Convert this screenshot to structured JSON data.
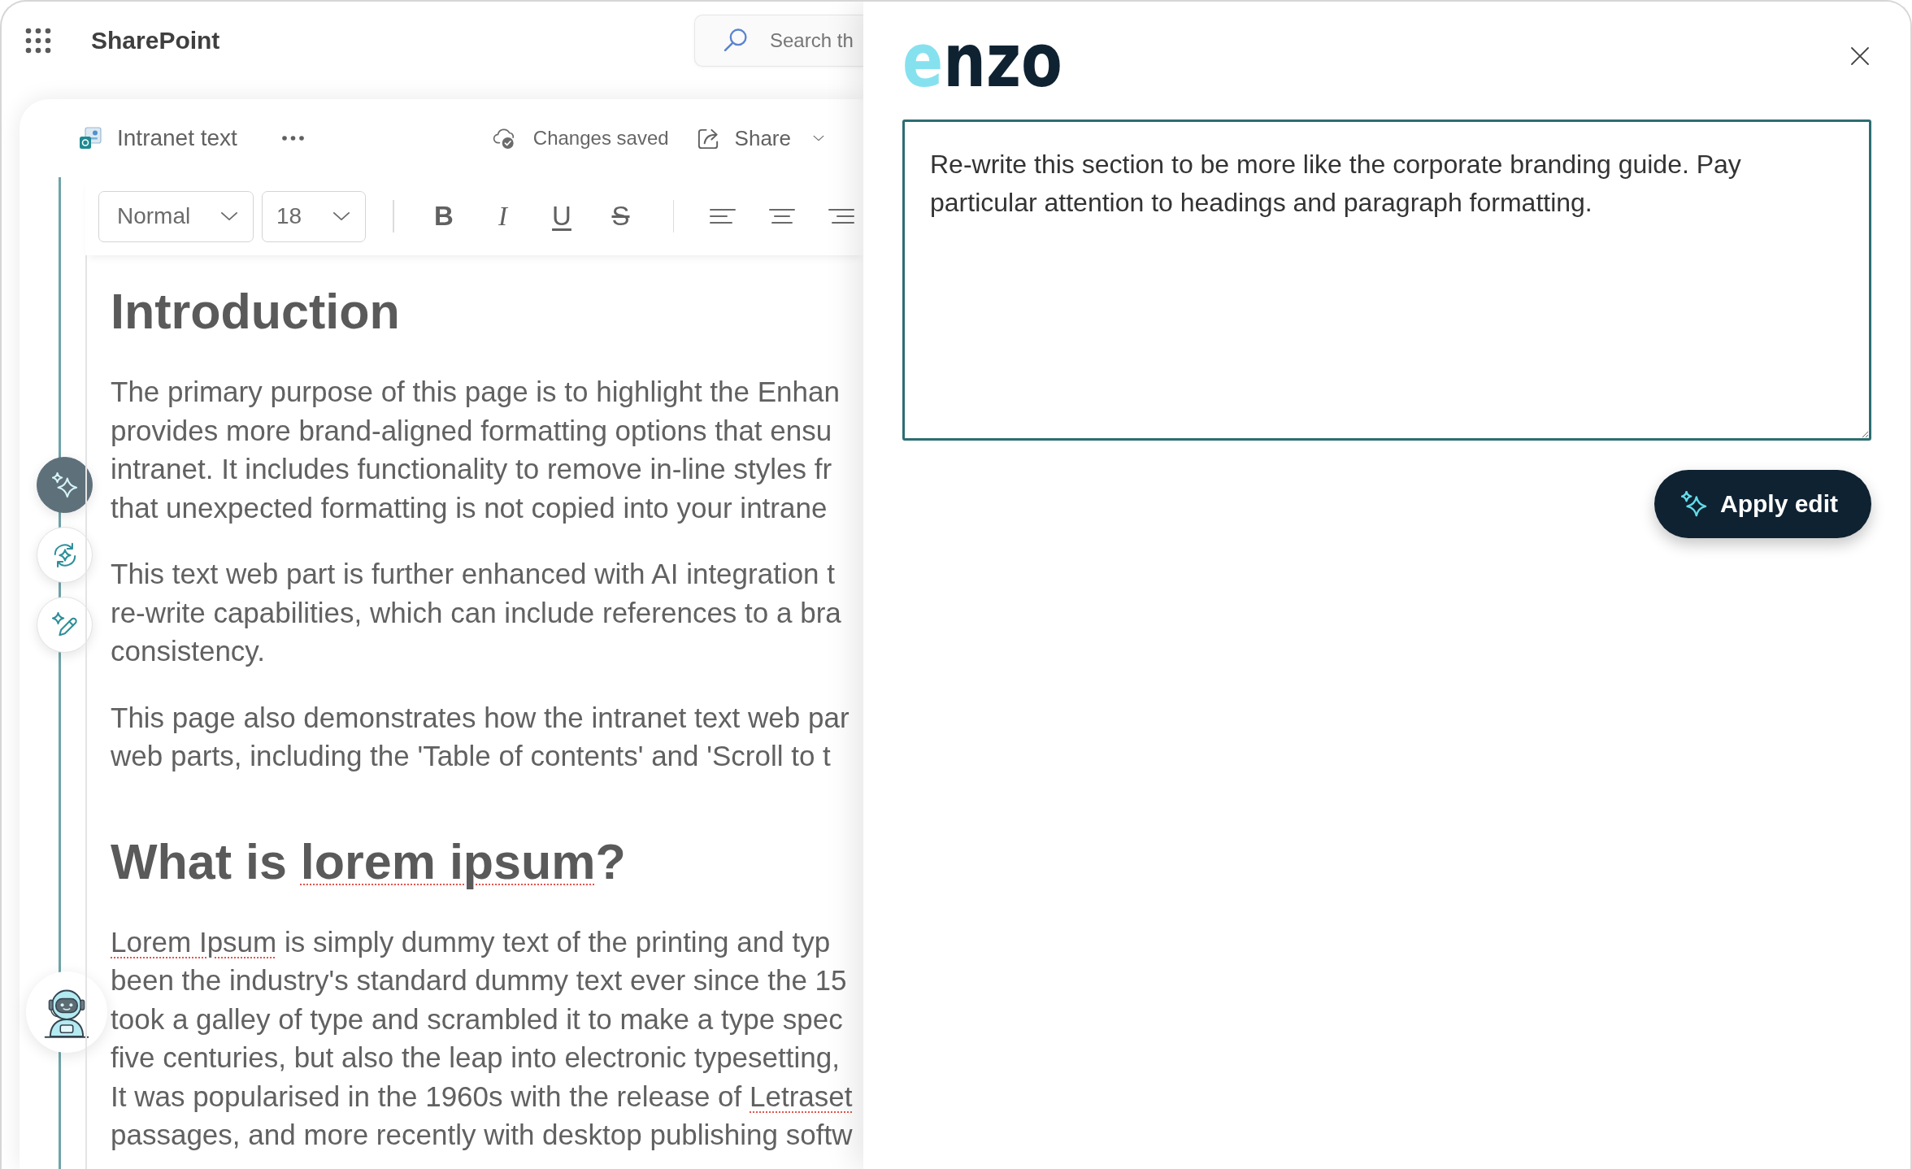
{
  "app_bar": {
    "app_name": "SharePoint",
    "search": {
      "placeholder": "Search th"
    }
  },
  "command_bar": {
    "page_title": "Intranet text",
    "save_status": "Changes saved",
    "share": "Share"
  },
  "format_toolbar": {
    "text_style": "Normal",
    "font_size": "18",
    "text_buttons": [
      {
        "kind": "bold",
        "label": "B"
      },
      {
        "kind": "italic",
        "label": "I"
      },
      {
        "kind": "underline",
        "label": "U"
      },
      {
        "kind": "strikethrough",
        "label": "S"
      }
    ]
  },
  "ai_actions": [
    {
      "kind": "sparkles",
      "selected": true
    },
    {
      "kind": "sparkle-refresh",
      "selected": false
    },
    {
      "kind": "sparkle-pencil",
      "selected": false
    }
  ],
  "content": [
    {
      "kind": "heading",
      "lines": [
        "Introduction"
      ]
    },
    {
      "kind": "paragraph",
      "lines": [
        "The primary purpose of this page is to highlight the Enhan",
        "provides more brand-aligned formatting options that ensu",
        "intranet. It includes functionality to remove in-line styles fr",
        "that unexpected formatting is not copied into your intrane"
      ]
    },
    {
      "kind": "paragraph",
      "lines": [
        "This text web part is further enhanced with AI integration t",
        "re-write capabilities, which can include references to a bra",
        "consistency."
      ]
    },
    {
      "kind": "paragraph",
      "lines": [
        "This page also demonstrates how the intranet text web par",
        "web parts, including the 'Table of contents' and 'Scroll to t"
      ]
    },
    {
      "kind": "heading",
      "lines": [
        [
          {
            "text": "What is ",
            "misspelled": false
          },
          {
            "text": "lorem ipsum",
            "misspelled": true
          },
          {
            "text": "?",
            "misspelled": false
          }
        ]
      ]
    },
    {
      "kind": "paragraph",
      "lines": [
        [
          {
            "text": "Lorem Ipsum",
            "misspelled": true
          },
          {
            "text": " is simply dummy text of the printing and typ",
            "misspelled": false
          }
        ],
        "been the industry's standard dummy text ever since the 15",
        "took a galley of type and scrambled it to make a type spec",
        "five centuries, but also the leap into electronic typesetting,",
        [
          {
            "text": "It was popularised in the 1960s with the release of ",
            "misspelled": false
          },
          {
            "text": "Letraset",
            "misspelled": true
          }
        ],
        "passages, and more recently with desktop publishing softw"
      ]
    }
  ],
  "panel": {
    "logo": "enzo",
    "prompt": {
      "value": "Re-write this section to be more like the corporate branding guide. Pay particular attention to headings and paragraph formatting."
    },
    "apply_button": "Apply edit"
  }
}
